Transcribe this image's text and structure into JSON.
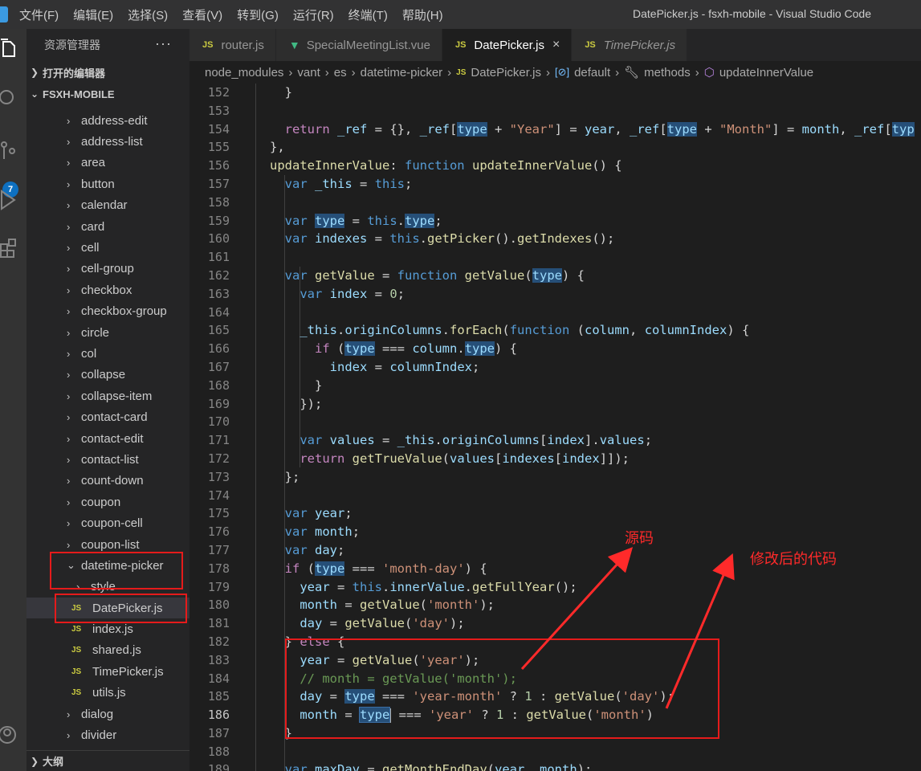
{
  "window": {
    "title": "DatePicker.js - fsxh-mobile - Visual Studio Code",
    "menu": [
      "文件(F)",
      "编辑(E)",
      "选择(S)",
      "查看(V)",
      "转到(G)",
      "运行(R)",
      "终端(T)",
      "帮助(H)"
    ]
  },
  "activity_bar": {
    "icons": [
      "explorer-icon",
      "search-icon",
      "source-control-icon",
      "run-debug-icon",
      "extensions-icon",
      "account-icon"
    ],
    "scm_badge": "7"
  },
  "sidebar": {
    "title": "资源管理器",
    "more": "···",
    "open_editors_label": "打开的编辑器",
    "project_label": "FSXH-MOBILE",
    "outline_label": "大纲",
    "tree": [
      {
        "label": "address-edit",
        "kind": "folder"
      },
      {
        "label": "address-list",
        "kind": "folder"
      },
      {
        "label": "area",
        "kind": "folder"
      },
      {
        "label": "button",
        "kind": "folder"
      },
      {
        "label": "calendar",
        "kind": "folder"
      },
      {
        "label": "card",
        "kind": "folder"
      },
      {
        "label": "cell",
        "kind": "folder"
      },
      {
        "label": "cell-group",
        "kind": "folder"
      },
      {
        "label": "checkbox",
        "kind": "folder"
      },
      {
        "label": "checkbox-group",
        "kind": "folder"
      },
      {
        "label": "circle",
        "kind": "folder"
      },
      {
        "label": "col",
        "kind": "folder"
      },
      {
        "label": "collapse",
        "kind": "folder"
      },
      {
        "label": "collapse-item",
        "kind": "folder"
      },
      {
        "label": "contact-card",
        "kind": "folder"
      },
      {
        "label": "contact-edit",
        "kind": "folder"
      },
      {
        "label": "contact-list",
        "kind": "folder"
      },
      {
        "label": "count-down",
        "kind": "folder"
      },
      {
        "label": "coupon",
        "kind": "folder"
      },
      {
        "label": "coupon-cell",
        "kind": "folder"
      },
      {
        "label": "coupon-list",
        "kind": "folder"
      },
      {
        "label": "datetime-picker",
        "kind": "folder-open"
      },
      {
        "label": "style",
        "kind": "subfolder"
      },
      {
        "label": "DatePicker.js",
        "kind": "file",
        "selected": true
      },
      {
        "label": "index.js",
        "kind": "file"
      },
      {
        "label": "shared.js",
        "kind": "file"
      },
      {
        "label": "TimePicker.js",
        "kind": "file"
      },
      {
        "label": "utils.js",
        "kind": "file"
      },
      {
        "label": "dialog",
        "kind": "folder"
      },
      {
        "label": "divider",
        "kind": "folder"
      }
    ]
  },
  "tabs": [
    {
      "label": "router.js",
      "kind": "js",
      "active": false,
      "italic": false
    },
    {
      "label": "SpecialMeetingList.vue",
      "kind": "vue",
      "active": false,
      "italic": false
    },
    {
      "label": "DatePicker.js",
      "kind": "js",
      "active": true,
      "italic": false,
      "close": "×"
    },
    {
      "label": "TimePicker.js",
      "kind": "js",
      "active": false,
      "italic": true
    }
  ],
  "breadcrumb": {
    "items": [
      "node_modules",
      "vant",
      "es",
      "datetime-picker",
      "DatePicker.js",
      "default",
      "methods",
      "updateInnerValue"
    ],
    "js_badge": "JS",
    "sym_badge": "[⊘]"
  },
  "editor": {
    "current_line": 186,
    "line_numbers": [
      "152",
      "153",
      "154",
      "155",
      "156",
      "157",
      "158",
      "159",
      "160",
      "161",
      "162",
      "163",
      "164",
      "165",
      "166",
      "167",
      "168",
      "169",
      "170",
      "171",
      "172",
      "173",
      "174",
      "175",
      "176",
      "177",
      "178",
      "179",
      "180",
      "181",
      "182",
      "183",
      "184",
      "185",
      "186",
      "187",
      "188",
      "189"
    ]
  },
  "annotations": {
    "source_label": "源码",
    "modified_label": "修改后的代码"
  },
  "colors": {
    "annotation_red": "#e51b1b",
    "accent_blue": "#0e70c0",
    "editor_bg": "#1e1e1e"
  }
}
